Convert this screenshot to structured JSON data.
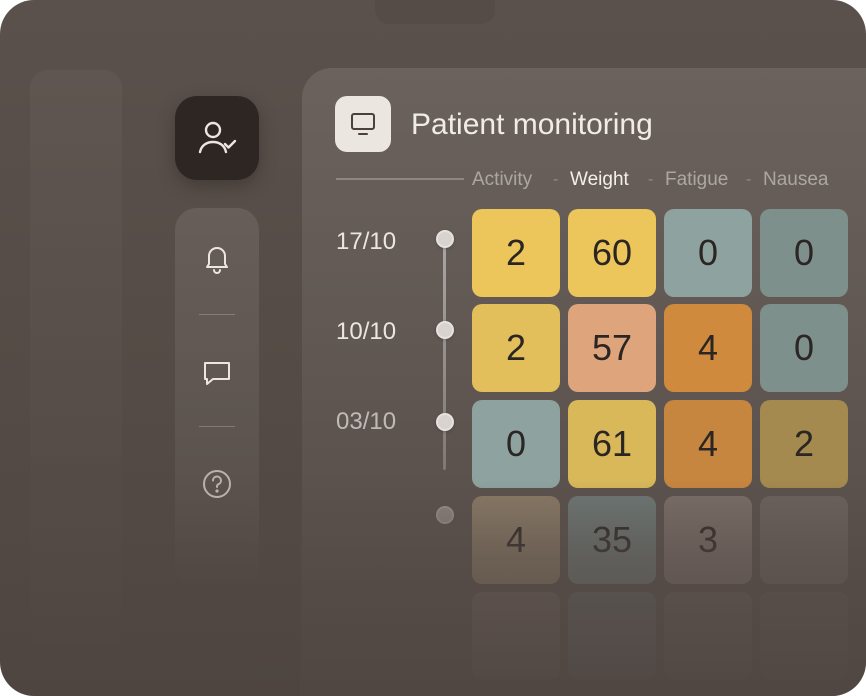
{
  "panel": {
    "title": "Patient monitoring"
  },
  "columns": [
    {
      "label": "Activity",
      "active": false
    },
    {
      "label": "Weight",
      "active": true
    },
    {
      "label": "Fatigue",
      "active": false
    },
    {
      "label": "Nausea",
      "active": false
    }
  ],
  "column_separator": "-",
  "rows": [
    {
      "date": "17/10",
      "values": [
        "2",
        "60",
        "0",
        "0"
      ]
    },
    {
      "date": "10/10",
      "values": [
        "2",
        "57",
        "4",
        "0"
      ]
    },
    {
      "date": "03/10",
      "values": [
        "0",
        "61",
        "4",
        "2"
      ]
    },
    {
      "date": "",
      "values": [
        "4",
        "35",
        "3",
        ""
      ]
    }
  ],
  "colors": {
    "yellow": "#ecc65b",
    "peach": "#dea57c",
    "orange": "#cf8a3e",
    "teal": "#8ea3a0",
    "teal_dark": "#7e908c",
    "olive": "#b39350"
  },
  "sidebar": {
    "items": [
      {
        "icon": "user-check-icon"
      },
      {
        "icon": "bell-icon"
      },
      {
        "icon": "chat-icon"
      },
      {
        "icon": "help-icon"
      }
    ]
  }
}
